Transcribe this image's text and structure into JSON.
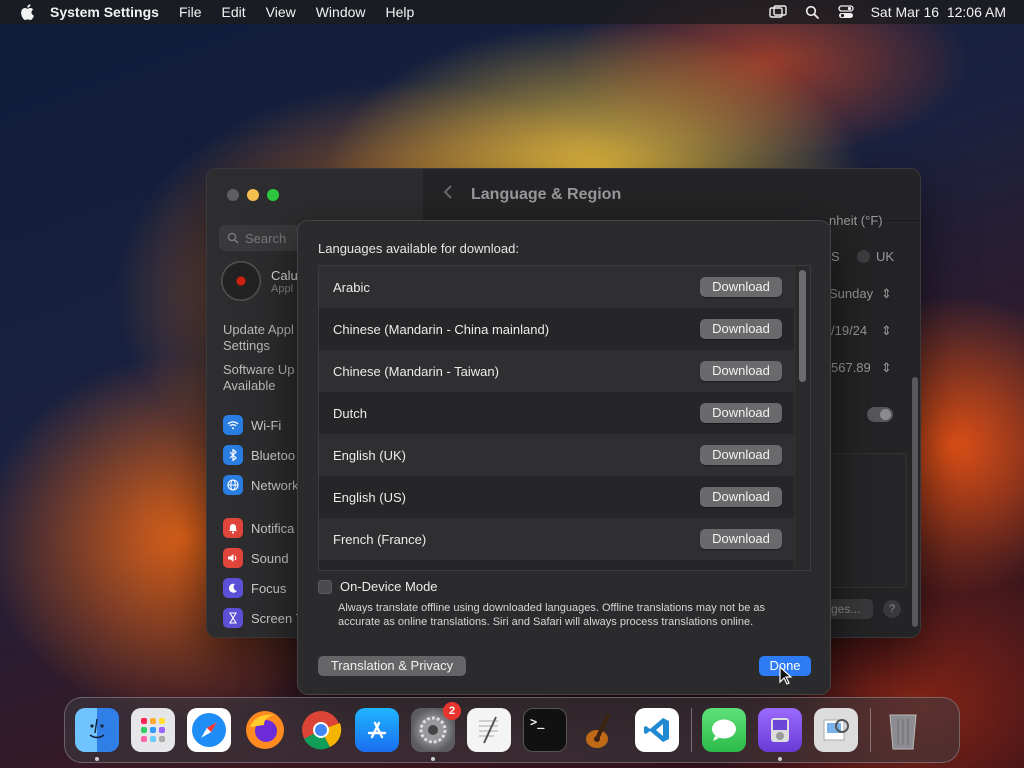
{
  "menubar": {
    "app": "System Settings",
    "menus": [
      "File",
      "Edit",
      "View",
      "Window",
      "Help"
    ],
    "datetime": "Sat Mar 16  12:06 AM"
  },
  "window": {
    "title": "Language & Region",
    "search_placeholder": "Search",
    "user_name": "Calu",
    "user_sub": "Appl",
    "update_settings": [
      "Update Appl",
      "Settings"
    ],
    "software_update": [
      "Software Up",
      "Available"
    ],
    "sidebar_items": [
      {
        "label": "Wi-Fi",
        "icon": "wifi-icon",
        "color": "#2a7de1"
      },
      {
        "label": "Bluetoo",
        "icon": "bluetooth-icon",
        "color": "#2a7de1"
      },
      {
        "label": "Network",
        "icon": "globe-icon",
        "color": "#2a7de1"
      },
      {
        "label": "Notifica",
        "icon": "bell-icon",
        "color": "#e0453b"
      },
      {
        "label": "Sound",
        "icon": "speaker-icon",
        "color": "#e0453b"
      },
      {
        "label": "Focus",
        "icon": "moon-icon",
        "color": "#5b50d6"
      },
      {
        "label": "Screen T",
        "icon": "hourglass-icon",
        "color": "#5b50d6"
      }
    ],
    "background_values": {
      "top_partial": "nheit (°F)",
      "radio_s": "S",
      "radio_uk": "UK",
      "first_day": "Sunday",
      "date_format": "/19/24",
      "number_format": "567.89",
      "languages_btn": "ges..."
    }
  },
  "sheet": {
    "heading": "Languages available for download:",
    "download_label": "Download",
    "languages": [
      "Arabic",
      "Chinese (Mandarin - China mainland)",
      "Chinese (Mandarin - Taiwan)",
      "Dutch",
      "English (UK)",
      "English (US)",
      "French (France)",
      ""
    ],
    "on_device_label": "On-Device Mode",
    "on_device_desc": "Always translate offline using downloaded languages. Offline translations may not be as accurate as online translations. Siri and Safari will always process translations online.",
    "translation_privacy": "Translation & Privacy",
    "done": "Done"
  },
  "dock": {
    "apps": [
      {
        "name": "finder",
        "color": "#3a8ef0",
        "dot": true,
        "badge": ""
      },
      {
        "name": "launchpad",
        "color": "#dcdcdc",
        "dot": false,
        "badge": ""
      },
      {
        "name": "safari",
        "color": "#1f8bf5",
        "dot": false,
        "badge": ""
      },
      {
        "name": "firefox",
        "color": "#ff7a1a",
        "dot": false,
        "badge": ""
      },
      {
        "name": "chrome",
        "color": "#ffffff",
        "dot": false,
        "badge": ""
      },
      {
        "name": "app-store",
        "color": "#1a8cf5",
        "dot": false,
        "badge": ""
      },
      {
        "name": "system-settings",
        "color": "#7b7b7e",
        "dot": true,
        "badge": "2"
      },
      {
        "name": "textedit",
        "color": "#f2f2f2",
        "dot": false,
        "badge": ""
      },
      {
        "name": "terminal",
        "color": "#1a1a1a",
        "dot": false,
        "badge": ""
      },
      {
        "name": "garageband",
        "color": "#5a3a1a",
        "dot": false,
        "badge": ""
      },
      {
        "name": "vscode",
        "color": "#ffffff",
        "dot": false,
        "badge": ""
      }
    ],
    "apps_right": [
      {
        "name": "messages",
        "color": "#34c759",
        "dot": false,
        "badge": ""
      },
      {
        "name": "ipod-app",
        "color": "#7c4fe0",
        "dot": true,
        "badge": ""
      },
      {
        "name": "preview",
        "color": "#d6d6d6",
        "dot": false,
        "badge": ""
      }
    ],
    "trash": {
      "name": "trash",
      "color": "#8c8c8f"
    }
  }
}
